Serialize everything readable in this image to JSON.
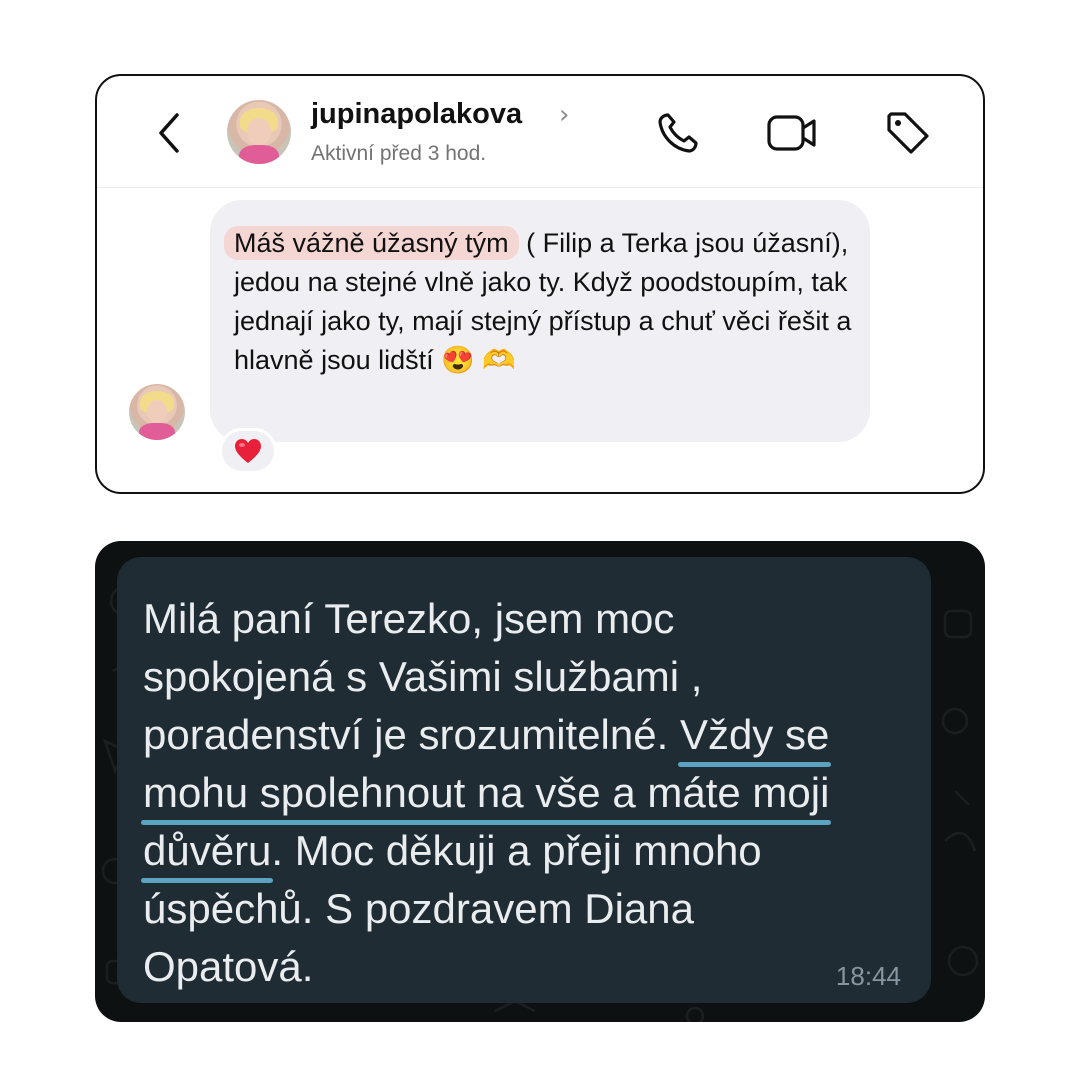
{
  "instagram": {
    "username": "jupinapolakova",
    "chevron": "›",
    "status": "Aktivní před 3 hod.",
    "message": {
      "highlighted": "Máš vážně úžasný tým",
      "rest": " ( Filip a Terka jsou úžasní), jedou na stejné vlně jako ty. Když poodstoupím, tak jednají jako ty, mají stejný přístup a chuť věci řešit a hlavně jsou lidští ",
      "emoji": "😍 🫶"
    },
    "reaction": "❤️",
    "icons": [
      "back-icon",
      "phone-icon",
      "video-icon",
      "tag-icon"
    ]
  },
  "whatsapp": {
    "line1": "Milá paní Terezko, jsem moc",
    "line2": "spokojená s Vašimi službami ,",
    "line3_plain": "poradenství je srozumitelné. ",
    "line3_underlined": "Vždy se",
    "line4_underlined": "mohu spolehnout na vše a máte moji",
    "line5_underlined": "důvěru",
    "line5_plain": ". Moc děkuji a přeji mnoho",
    "line6": "úspěchů. S pozdravem Diana",
    "line7": "Opatová.",
    "time": "18:44",
    "underline_color": "#5ba3c0",
    "bubble_color": "#202c33"
  }
}
